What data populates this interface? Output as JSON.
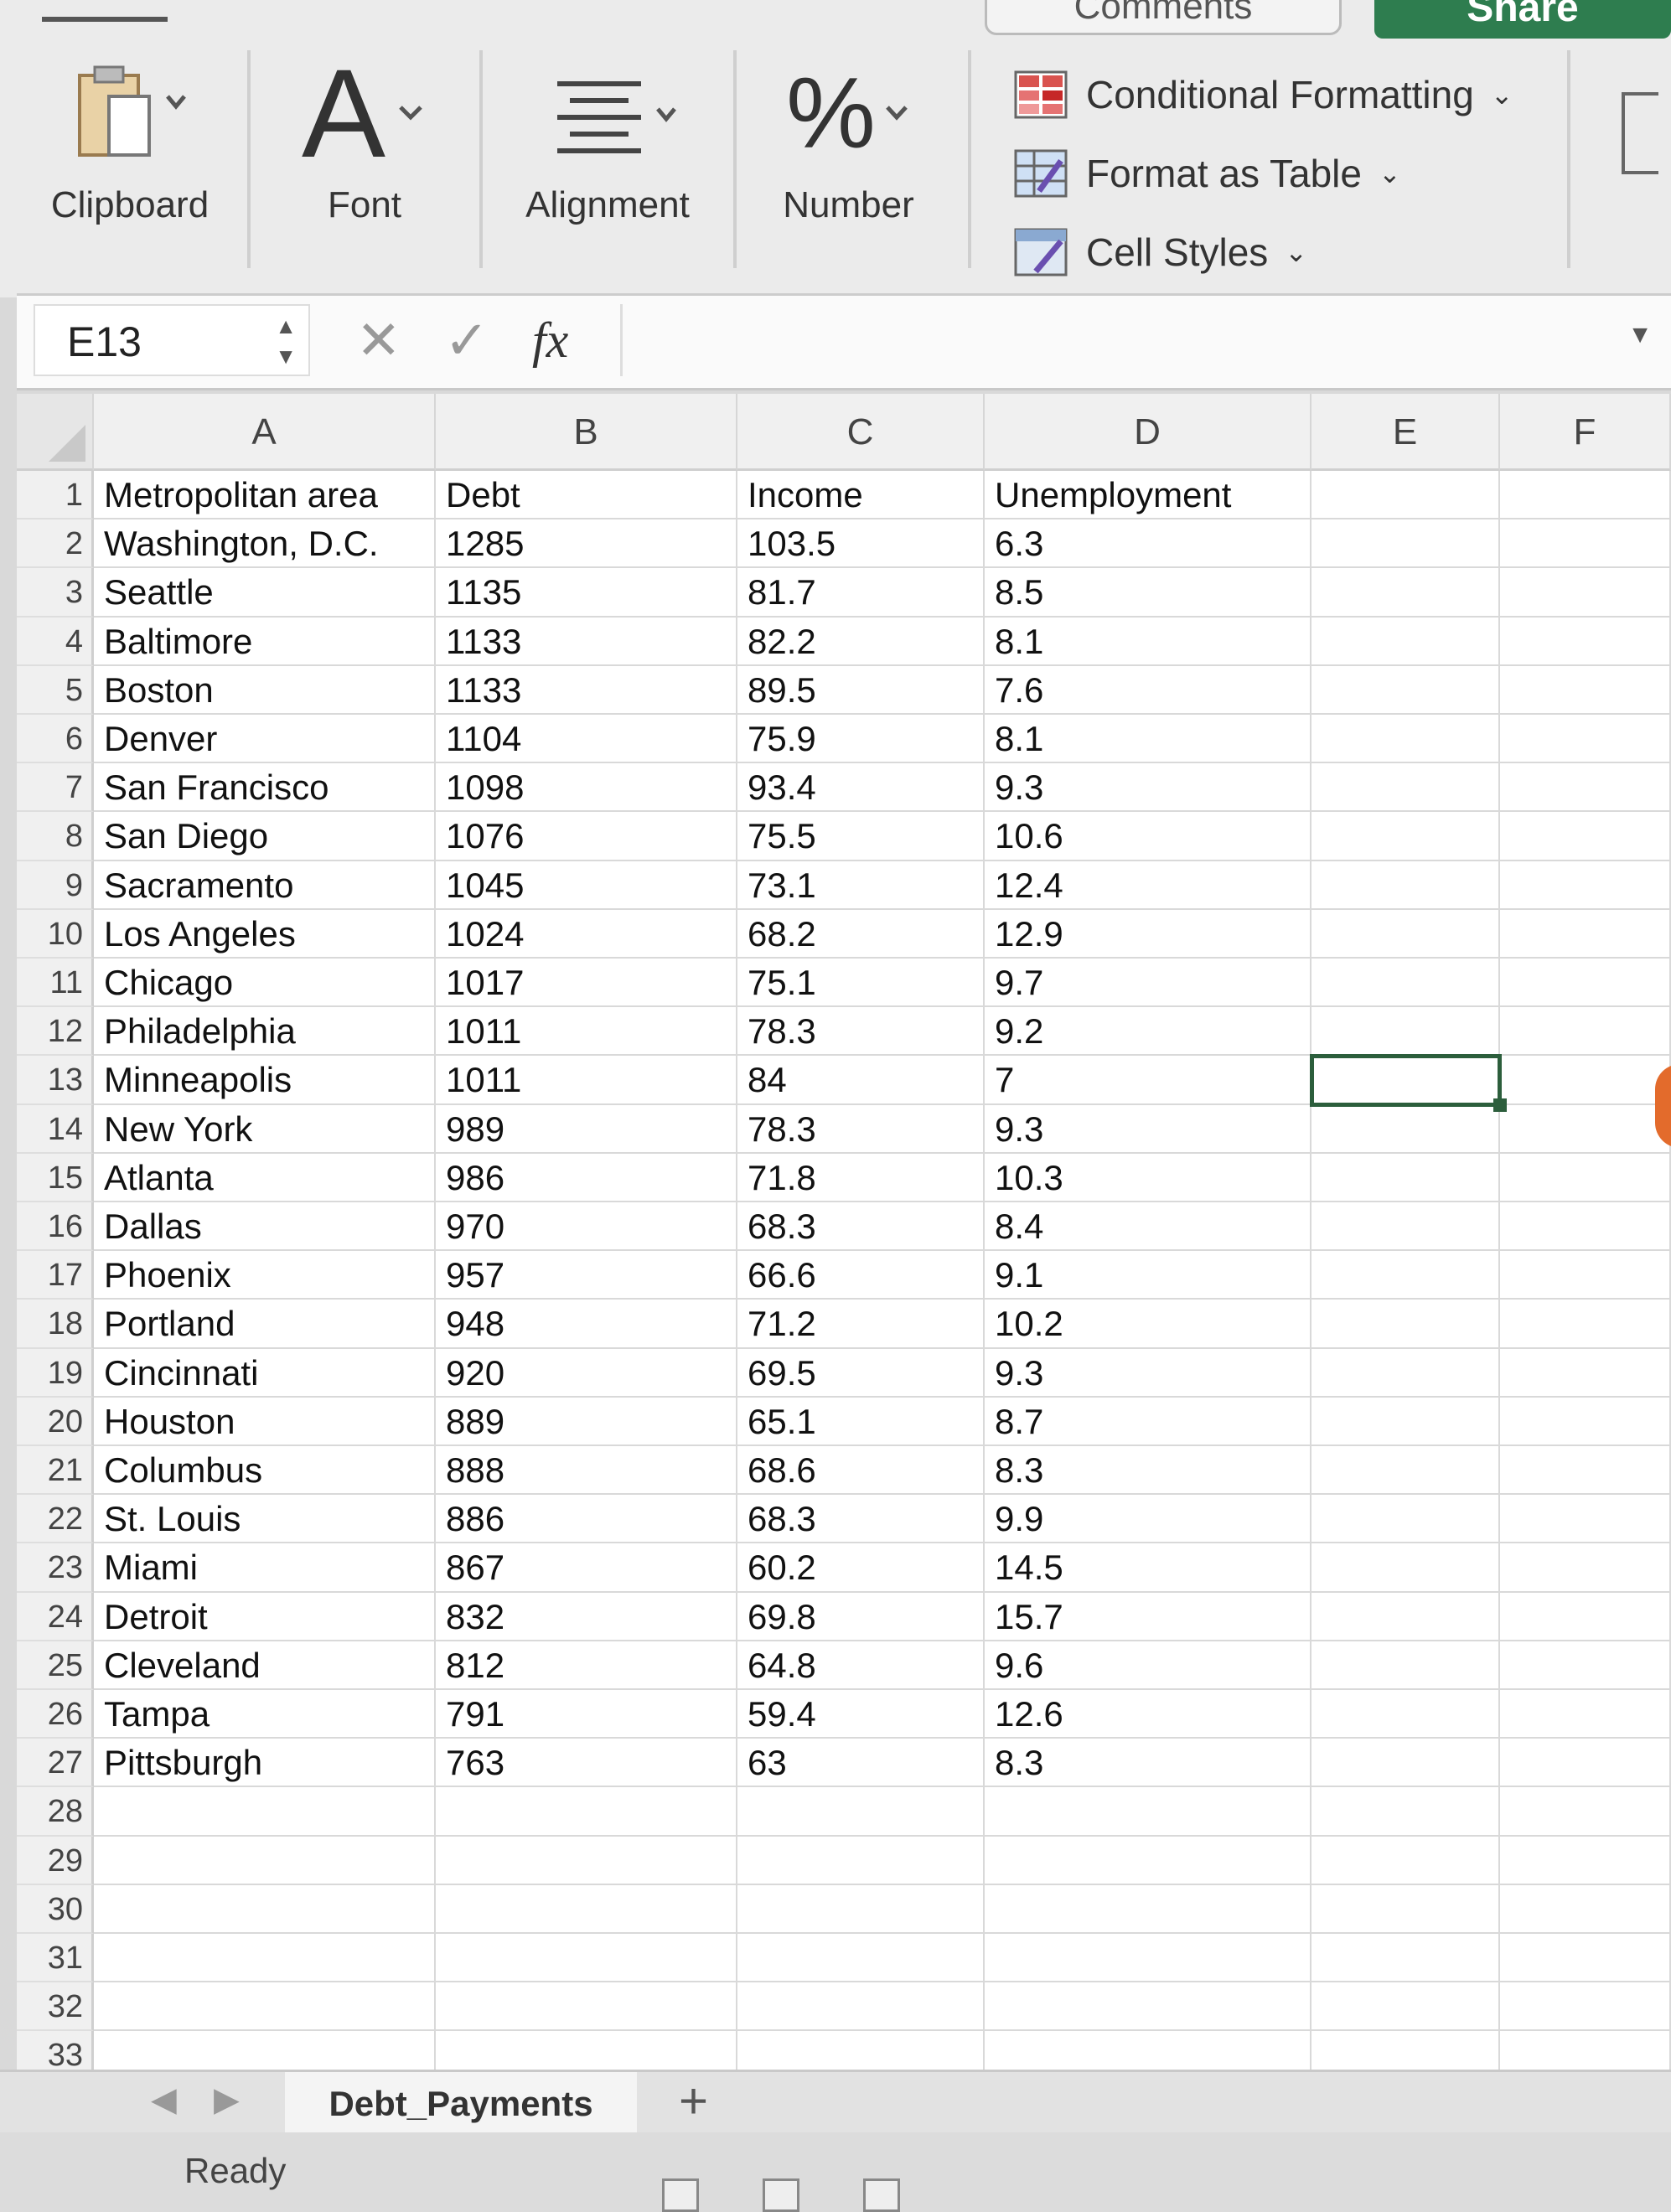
{
  "ribbon": {
    "clipboard_label": "Clipboard",
    "font_label": "Font",
    "font_glyph": "A",
    "alignment_label": "Alignment",
    "number_label": "Number",
    "number_glyph": "%",
    "conditional_formatting": "Conditional Formatting",
    "format_as_table": "Format as Table",
    "cell_styles": "Cell Styles",
    "share_label": "Share",
    "comments_label": "Comments"
  },
  "formula_bar": {
    "name_box": "E13",
    "fx_label": "fx",
    "formula": ""
  },
  "columns": [
    "A",
    "B",
    "C",
    "D",
    "E",
    "F"
  ],
  "rows": [
    [
      "Metropolitan area",
      "Debt",
      "Income",
      "Unemployment"
    ],
    [
      "Washington, D.C.",
      "1285",
      "103.5",
      "6.3"
    ],
    [
      "Seattle",
      "1135",
      "81.7",
      "8.5"
    ],
    [
      "Baltimore",
      "1133",
      "82.2",
      "8.1"
    ],
    [
      "Boston",
      "1133",
      "89.5",
      "7.6"
    ],
    [
      "Denver",
      "1104",
      "75.9",
      "8.1"
    ],
    [
      "San Francisco",
      "1098",
      "93.4",
      "9.3"
    ],
    [
      "San Diego",
      "1076",
      "75.5",
      "10.6"
    ],
    [
      "Sacramento",
      "1045",
      "73.1",
      "12.4"
    ],
    [
      "Los Angeles",
      "1024",
      "68.2",
      "12.9"
    ],
    [
      "Chicago",
      "1017",
      "75.1",
      "9.7"
    ],
    [
      "Philadelphia",
      "1011",
      "78.3",
      "9.2"
    ],
    [
      "Minneapolis",
      "1011",
      "84",
      "7"
    ],
    [
      "New York",
      "989",
      "78.3",
      "9.3"
    ],
    [
      "Atlanta",
      "986",
      "71.8",
      "10.3"
    ],
    [
      "Dallas",
      "970",
      "68.3",
      "8.4"
    ],
    [
      "Phoenix",
      "957",
      "66.6",
      "9.1"
    ],
    [
      "Portland",
      "948",
      "71.2",
      "10.2"
    ],
    [
      "Cincinnati",
      "920",
      "69.5",
      "9.3"
    ],
    [
      "Houston",
      "889",
      "65.1",
      "8.7"
    ],
    [
      "Columbus",
      "888",
      "68.6",
      "8.3"
    ],
    [
      "St. Louis",
      "886",
      "68.3",
      "9.9"
    ],
    [
      "Miami",
      "867",
      "60.2",
      "14.5"
    ],
    [
      "Detroit",
      "832",
      "69.8",
      "15.7"
    ],
    [
      "Cleveland",
      "812",
      "64.8",
      "9.6"
    ],
    [
      "Tampa",
      "791",
      "59.4",
      "12.6"
    ],
    [
      "Pittsburgh",
      "763",
      "63",
      "8.3"
    ],
    [
      "",
      "",
      "",
      ""
    ],
    [
      "",
      "",
      "",
      ""
    ],
    [
      "",
      "",
      "",
      ""
    ],
    [
      "",
      "",
      "",
      ""
    ],
    [
      "",
      "",
      "",
      ""
    ],
    [
      "",
      "",
      "",
      ""
    ],
    [
      "",
      "",
      "",
      ""
    ]
  ],
  "selected_cell": "E13",
  "sheet_tab": "Debt_Payments",
  "add_sheet": "+",
  "status": "Ready",
  "colors": {
    "accent_green": "#2e7d4f",
    "selection": "#2c5e3c"
  }
}
